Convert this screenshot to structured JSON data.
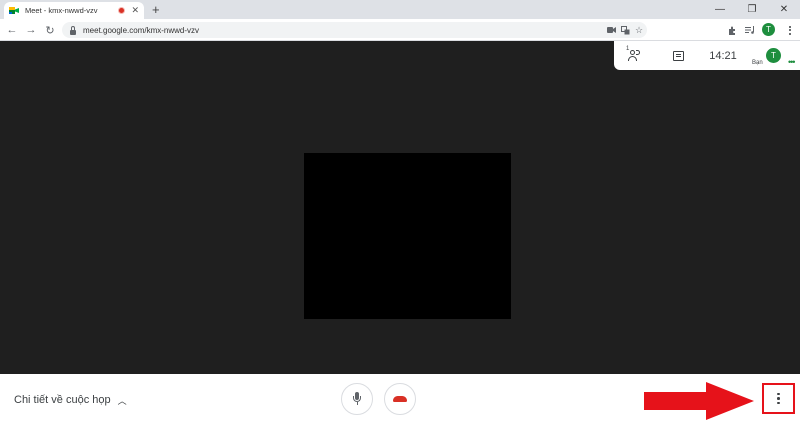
{
  "browser": {
    "tab": {
      "title": "Meet - kmx-nwwd-vzv",
      "favicon": "google-meet-icon",
      "recording_indicator": "red-dot-icon",
      "close_label": "✕"
    },
    "new_tab_label": "+",
    "window_controls": {
      "minimize": "—",
      "restore": "❐",
      "close": "✕"
    },
    "nav": {
      "back": "←",
      "forward": "→",
      "reload": "↻"
    },
    "url": "meet.google.com/kmx-nwwd-vzv",
    "profile_initial": "T"
  },
  "meet": {
    "people_count": "1",
    "clock": "14:21",
    "avatar_initial": "T",
    "you_label": "Bạn",
    "bottom": {
      "details_label": "Chi tiết về cuộc họp",
      "details_chevron": "︿"
    }
  },
  "colors": {
    "stage_bg": "#1f1f1f",
    "accent_green": "#1e8e3e",
    "hangup_red": "#d93025",
    "annotation_red": "#e6121a"
  }
}
